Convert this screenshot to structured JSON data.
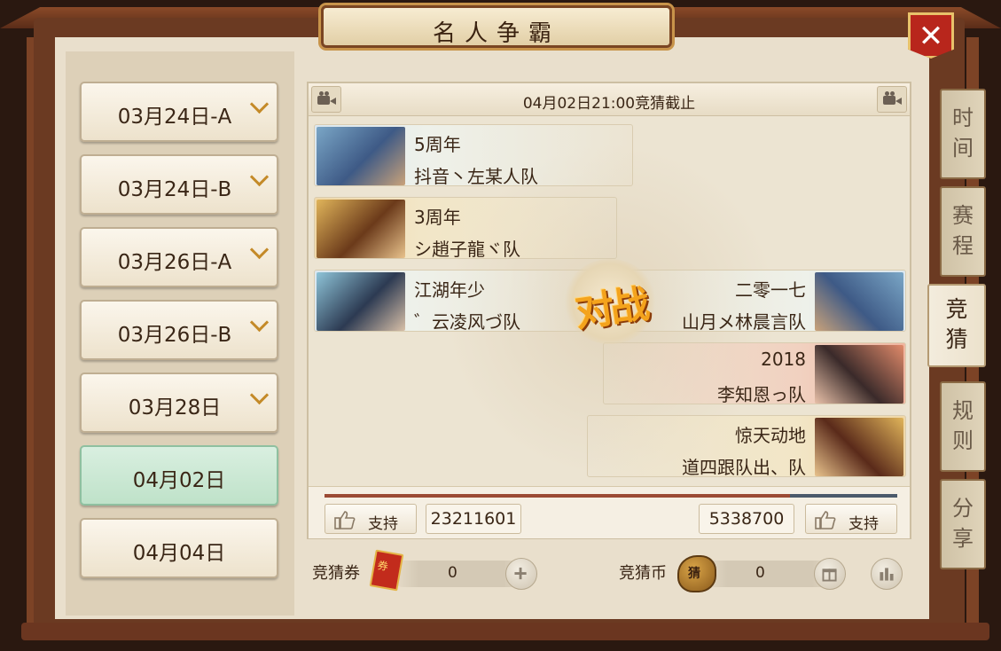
{
  "title": "名人争霸",
  "close_label": "✕",
  "dates": [
    {
      "label": "03月24日-A",
      "has_chevron": true,
      "active": false
    },
    {
      "label": "03月24日-B",
      "has_chevron": true,
      "active": false
    },
    {
      "label": "03月26日-A",
      "has_chevron": true,
      "active": false
    },
    {
      "label": "03月26日-B",
      "has_chevron": true,
      "active": false
    },
    {
      "label": "03月28日",
      "has_chevron": true,
      "active": false
    },
    {
      "label": "04月02日",
      "has_chevron": false,
      "active": true
    },
    {
      "label": "04月04日",
      "has_chevron": false,
      "active": false
    }
  ],
  "header": {
    "deadline": "04月02日21:00竞猜截止"
  },
  "left_teams": [
    {
      "seed": "5周年",
      "name": "抖音丶左某人队"
    },
    {
      "seed": "3周年",
      "name": "シ趙子龍ヾ队"
    },
    {
      "seed": "江湖年少",
      "name": "゛云凌风づ队"
    }
  ],
  "right_teams": [
    {
      "seed": "二零一七",
      "name": "山月メ林晨言队"
    },
    {
      "seed": "2018",
      "name": "李知恩っ队"
    },
    {
      "seed": "惊天动地",
      "name": "道四跟队出、队"
    }
  ],
  "vs_label": "对战",
  "support": {
    "left_label": "支持",
    "right_label": "支持",
    "left_count": "23211601",
    "right_count": "5338700",
    "left_share": 0.813
  },
  "currency": {
    "ticket_label": "竞猜券",
    "ticket_value": "0",
    "ticket_glyph": "券",
    "coin_label": "竞猜币",
    "coin_value": "0",
    "coin_glyph": "猜"
  },
  "side_tabs": [
    {
      "label": "时间",
      "active": false
    },
    {
      "label": "赛程",
      "active": false
    },
    {
      "label": "竞猜",
      "active": true
    },
    {
      "label": "规则",
      "active": false
    },
    {
      "label": "分享",
      "active": false
    }
  ],
  "colors": {
    "frame": "#6b3a22",
    "panel": "#e9dfcc",
    "active_date": "#bfe2c9",
    "accent_gold": "#c48a28",
    "close_red": "#b8261c",
    "vs_orange": "#f4a31c"
  }
}
